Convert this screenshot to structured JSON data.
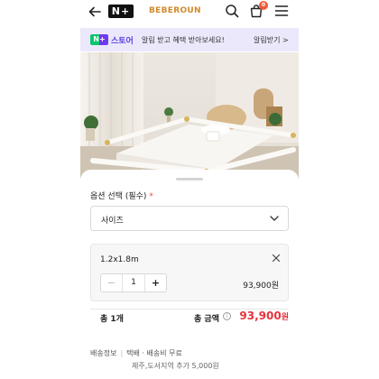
{
  "nav": {
    "logo": "N+",
    "brand": "BEBEROUN",
    "cart_count": "0"
  },
  "promo": {
    "logo_badge": "N+",
    "store": "스토어",
    "text": "알림 받고 혜택 받아보세요!",
    "cta": "알림받기 >"
  },
  "sheet": {
    "option_title": "옵션 선택 (필수)",
    "required_mark": "*",
    "select_value": "사이즈",
    "item": {
      "name": "1.2x1.8m",
      "quantity": "1",
      "minus": "−",
      "plus": "+",
      "price": "93,900원"
    },
    "total": {
      "count": "총 1개",
      "label": "총 금액",
      "info": "i",
      "price": "93,900",
      "unit": "원"
    },
    "shipping": {
      "label": "배송정보",
      "method": "택배 · 배송비 무료",
      "extra": "제주,도서지역 추가 5,000원"
    }
  },
  "colors": {
    "brand": "#d08a2c",
    "promo_bg": "#ece8fb",
    "price_red": "#e8323c",
    "required": "#f04a3a"
  },
  "icons": [
    "back-arrow-icon",
    "search-icon",
    "shopping-bag-icon",
    "hamburger-menu-icon",
    "chevron-down-icon",
    "close-icon",
    "info-icon"
  ]
}
